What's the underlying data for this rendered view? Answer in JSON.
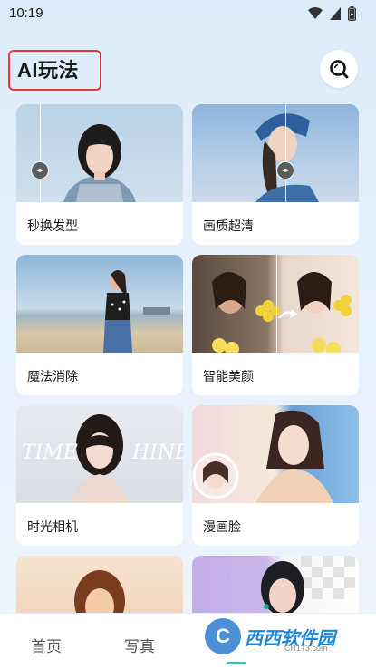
{
  "status": {
    "time": "10:19"
  },
  "header": {
    "title": "AI玩法"
  },
  "cards": [
    {
      "label": "秒换发型"
    },
    {
      "label": "画质超清"
    },
    {
      "label": "魔法消除"
    },
    {
      "label": "智能美颜"
    },
    {
      "label": "时光相机",
      "overlay_left": "TIME",
      "overlay_right": "HINE"
    },
    {
      "label": "漫画脸"
    },
    {
      "label": ""
    },
    {
      "label": ""
    }
  ],
  "nav": {
    "home": "首页",
    "portrait": "写真"
  },
  "watermark": {
    "brand": "西西软件园",
    "site": "CR173.com"
  },
  "colors": {
    "accent": "#e53935",
    "background": "#dcebfb"
  }
}
